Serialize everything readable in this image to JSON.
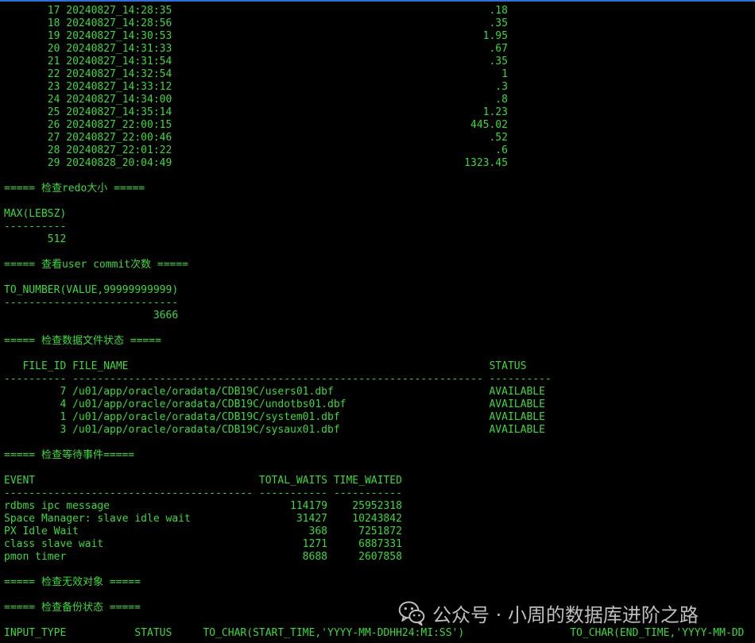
{
  "terminal": {
    "lines": [
      "       17 20240827_14:28:35                                                   .18",
      "       18 20240827_14:28:56                                                   .35",
      "       19 20240827_14:30:53                                                  1.95",
      "       20 20240827_14:31:33                                                   .67",
      "       21 20240827_14:31:54                                                   .35",
      "       22 20240827_14:32:54                                                     1",
      "       23 20240827_14:33:12                                                    .3",
      "       24 20240827_14:34:00                                                    .8",
      "       25 20240827_14:35:14                                                  1.23",
      "       26 20240827_22:00:15                                                445.02",
      "       27 20240827_22:00:46                                                   .52",
      "       28 20240827_22:01:22                                                    .6",
      "       29 20240828_20:04:49                                               1323.45",
      "",
      "===== 检查redo大小 =====",
      "",
      "MAX(LEBSZ)",
      "----------",
      "       512",
      "",
      "===== 查看user commit次数 =====",
      "",
      "TO_NUMBER(VALUE,99999999999)",
      "----------------------------",
      "                        3666",
      "",
      "===== 检查数据文件状态 =====",
      "",
      "   FILE_ID FILE_NAME                                                          STATUS",
      "---------- ------------------------------------------------------------------ ----------",
      "         7 /u01/app/oracle/oradata/CDB19C/users01.dbf                         AVAILABLE",
      "         4 /u01/app/oracle/oradata/CDB19C/undotbs01.dbf                       AVAILABLE",
      "         1 /u01/app/oracle/oradata/CDB19C/system01.dbf                        AVAILABLE",
      "         3 /u01/app/oracle/oradata/CDB19C/sysaux01.dbf                        AVAILABLE",
      "",
      "===== 检查等待事件=====",
      "",
      "EVENT                                    TOTAL_WAITS TIME_WAITED",
      "---------------------------------------- ----------- -----------",
      "rdbms ipc message                             114179    25952318",
      "Space Manager: slave idle wait                 31427    10243842",
      "PX Idle Wait                                     368     7251872",
      "class slave wait                                1271     6887331",
      "pmon timer                                      8688     2607858",
      "",
      "===== 检查无效对象 =====",
      "",
      "===== 检查备份状态 =====",
      "",
      "INPUT_TYPE           STATUS     TO_CHAR(START_TIME,'YYYY-MM-DDHH24:MI:SS')                 TO_CHAR(END_TIME,'YYYY-MM-DD"
    ]
  },
  "watermark": {
    "text": "公众号 · 小周的数据库进阶之路",
    "icon": "wechat-icon"
  },
  "colors": {
    "background": "#000000",
    "text": "#3cd93c",
    "watermark": "#cfcfcf",
    "title_bar_accent": "#2f6fd6"
  }
}
